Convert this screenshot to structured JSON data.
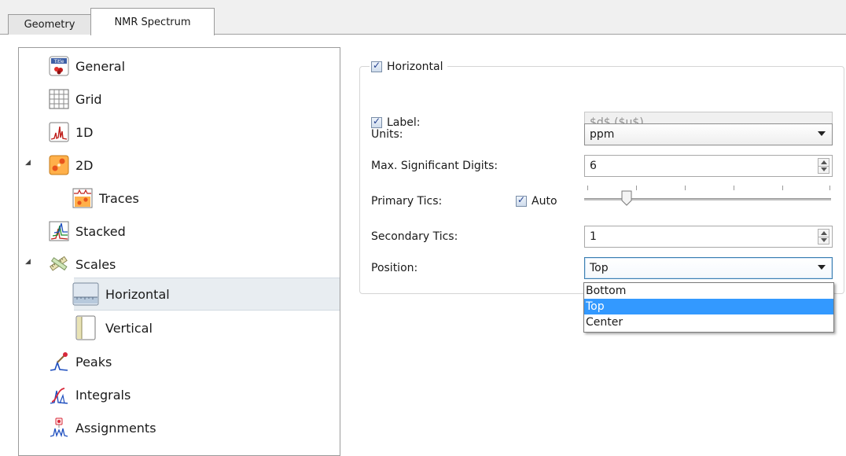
{
  "tabs": [
    {
      "label": "Geometry",
      "active": false
    },
    {
      "label": "NMR Spectrum",
      "active": true
    }
  ],
  "tree": {
    "items": [
      {
        "label": "General",
        "icon": "title-icon"
      },
      {
        "label": "Grid",
        "icon": "grid-icon"
      },
      {
        "label": "1D",
        "icon": "spectrum-1d-icon"
      },
      {
        "label": "2D",
        "icon": "spectrum-2d-icon",
        "expanded": true
      },
      {
        "label": "Traces",
        "icon": "traces-icon"
      },
      {
        "label": "Stacked",
        "icon": "stacked-icon"
      },
      {
        "label": "Scales",
        "icon": "scales-icon",
        "expanded": true
      },
      {
        "label": "Horizontal",
        "icon": "horizontal-scale-icon",
        "selected": true
      },
      {
        "label": "Vertical",
        "icon": "vertical-scale-icon"
      },
      {
        "label": "Peaks",
        "icon": "peaks-icon"
      },
      {
        "label": "Integrals",
        "icon": "integrals-icon"
      },
      {
        "label": "Assignments",
        "icon": "assignments-icon"
      }
    ]
  },
  "panel": {
    "group_title": "Horizontal",
    "group_checked": true,
    "label_caption": "Label:",
    "label_checked": true,
    "label_value": "$d$ ($u$)",
    "units_caption": "Units:",
    "units_value": "ppm",
    "digits_caption": "Max. Significant Digits:",
    "digits_value": "6",
    "primary_caption": "Primary Tics:",
    "auto_caption": "Auto",
    "auto_checked": true,
    "primary_slider_level": 0.17,
    "secondary_caption": "Secondary Tics:",
    "secondary_value": "1",
    "position_caption": "Position:",
    "position_value": "Top",
    "position_options": [
      "Bottom",
      "Top",
      "Center"
    ],
    "position_highlighted": "Top"
  },
  "colors": {
    "highlight": "#3399ff",
    "selection": "#e8edf1"
  }
}
